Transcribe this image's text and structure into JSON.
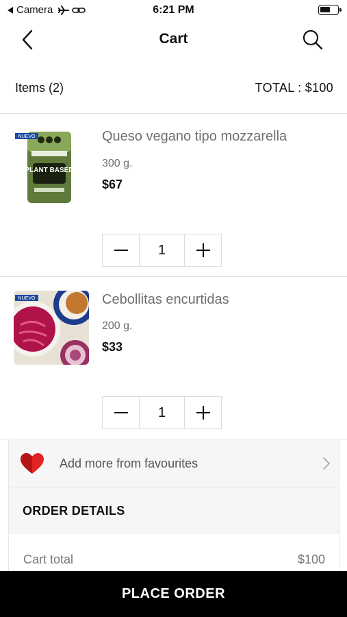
{
  "status_bar": {
    "back_app": "Camera",
    "time": "6:21 PM"
  },
  "nav": {
    "title": "Cart",
    "back_icon": "chevron-left-icon",
    "search_icon": "search-icon"
  },
  "summary": {
    "items_label": "Items (2)",
    "total_label": "TOTAL :  $100"
  },
  "cart_items": [
    {
      "name": "Queso vegano tipo mozzarella",
      "weight": "300 g.",
      "price": "$67",
      "quantity": "1",
      "badge": "NUEVO",
      "product_text": "PLANT BASED"
    },
    {
      "name": "Cebollitas encurtidas",
      "weight": "200 g.",
      "price": "$33",
      "quantity": "1",
      "badge": "NUEVO"
    }
  ],
  "favourites": {
    "label": "Add more from favourites",
    "icon": "heart-icon",
    "color": "#e02424"
  },
  "order_details": {
    "heading": "ORDER DETAILS",
    "rows": [
      {
        "label": "Cart total",
        "value": "$100"
      }
    ]
  },
  "place_order": {
    "label": "PLACE ORDER"
  }
}
